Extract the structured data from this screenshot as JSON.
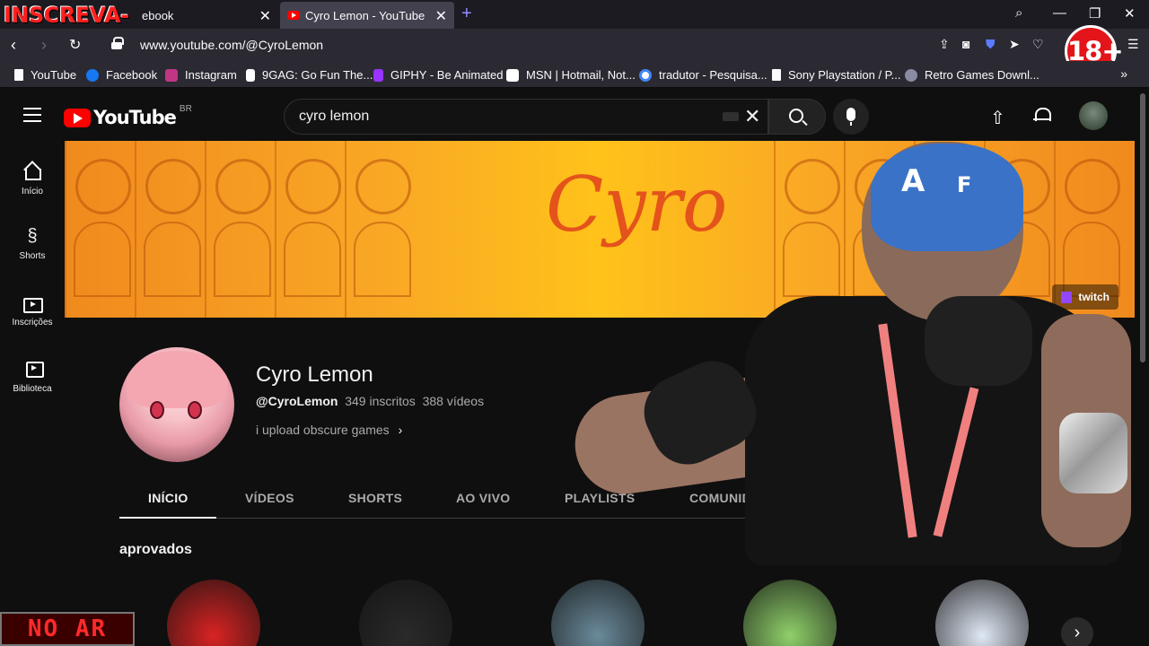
{
  "browser": {
    "tabs": [
      {
        "label": "ebook"
      },
      {
        "label": "Cyro Lemon - YouTube"
      }
    ],
    "new_tab": "+",
    "url": "www.youtube.com/@CyroLemon",
    "bookmarks": [
      {
        "label": "YouTube",
        "color": "#fbfbfe"
      },
      {
        "label": "Facebook",
        "color": "#1877f2"
      },
      {
        "label": "Instagram",
        "color": "#c13584"
      },
      {
        "label": "9GAG: Go Fun The...",
        "color": "#ffffff"
      },
      {
        "label": "GIPHY - Be Animated",
        "color": "#9933ff"
      },
      {
        "label": "MSN | Hotmail, Not...",
        "color": "#ffffff"
      },
      {
        "label": "tradutor - Pesquisa...",
        "color": "#4285f4"
      },
      {
        "label": "Sony Playstation / P...",
        "color": "#ffffff"
      },
      {
        "label": "Retro Games Downl...",
        "color": "#8a8aa0"
      }
    ]
  },
  "overlays": {
    "subscribe": "INSCREVA-SE",
    "age_badge": "18+",
    "live": "NO AR"
  },
  "youtube": {
    "logo_word": "YouTube",
    "country_code": "BR",
    "search_query": "cyro lemon",
    "sidebar": [
      {
        "label": "Início",
        "icon": "home-icon"
      },
      {
        "label": "Shorts",
        "icon": "shorts-icon"
      },
      {
        "label": "Inscrições",
        "icon": "subscriptions-icon"
      },
      {
        "label": "Biblioteca",
        "icon": "library-icon"
      }
    ],
    "banner": {
      "title": "Cyro",
      "twitch_label": "twitch"
    },
    "channel": {
      "name": "Cyro Lemon",
      "handle": "@CyroLemon",
      "subscribers": "349 inscritos",
      "videos": "388 vídeos",
      "description": "i upload obscure games"
    },
    "tabs": [
      {
        "label": "INÍCIO",
        "active": true
      },
      {
        "label": "VÍDEOS",
        "active": false
      },
      {
        "label": "SHORTS",
        "active": false
      },
      {
        "label": "AO VIVO",
        "active": false
      },
      {
        "label": "PLAYLISTS",
        "active": false
      },
      {
        "label": "COMUNIDADE",
        "active": false
      }
    ],
    "section_title": "aprovados",
    "channels_row": [
      {
        "color": "#d92323"
      },
      {
        "color": "#2a2a2a"
      },
      {
        "color": "#6a8a9a"
      },
      {
        "color": "#8fd06a"
      },
      {
        "color": "#dfe8f5"
      }
    ]
  }
}
